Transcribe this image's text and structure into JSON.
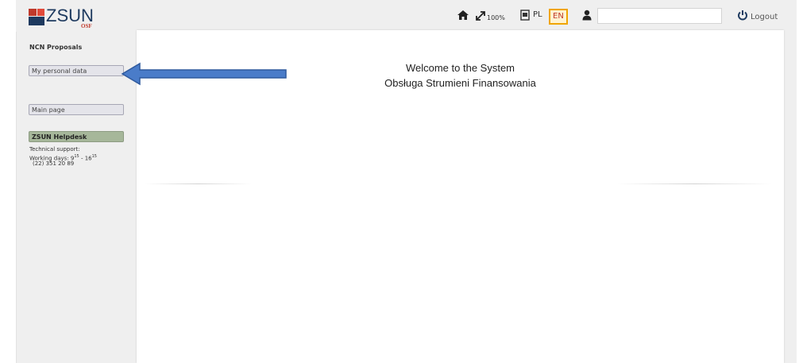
{
  "logo": {
    "text": "ZSUN",
    "subtext": "OSF",
    "colors": {
      "red": "#c0392b",
      "navy": "#1e3a5f"
    }
  },
  "toolbar": {
    "home_icon": "home-icon",
    "zoom_icon": "expand-icon",
    "zoom_label": "100%",
    "lang_icon": "flag-icon",
    "lang_pl": "PL",
    "lang_en": "EN",
    "user_icon": "user-icon",
    "search_value": "",
    "logout_label": "Logout"
  },
  "sidebar": {
    "section_title": "NCN Proposals",
    "personal_data_label": "My personal data",
    "main_page_label": "Main page",
    "helpdesk_title": "ZSUN Helpdesk",
    "helpdesk_support": "Technical support:",
    "helpdesk_days": "Working days: 9",
    "helpdesk_start_sup": "15",
    "helpdesk_sep": " - 16",
    "helpdesk_end_sup": "15",
    "helpdesk_phone": "(22) 351 20 89"
  },
  "main": {
    "welcome_line1": "Welcome to the System",
    "welcome_line2": "Obsługa Strumieni Finansowania"
  },
  "colors": {
    "accent_arrow": "#4a7cc9",
    "lang_active_border": "#f0a500",
    "helpdesk_bg": "#a6b79a"
  }
}
